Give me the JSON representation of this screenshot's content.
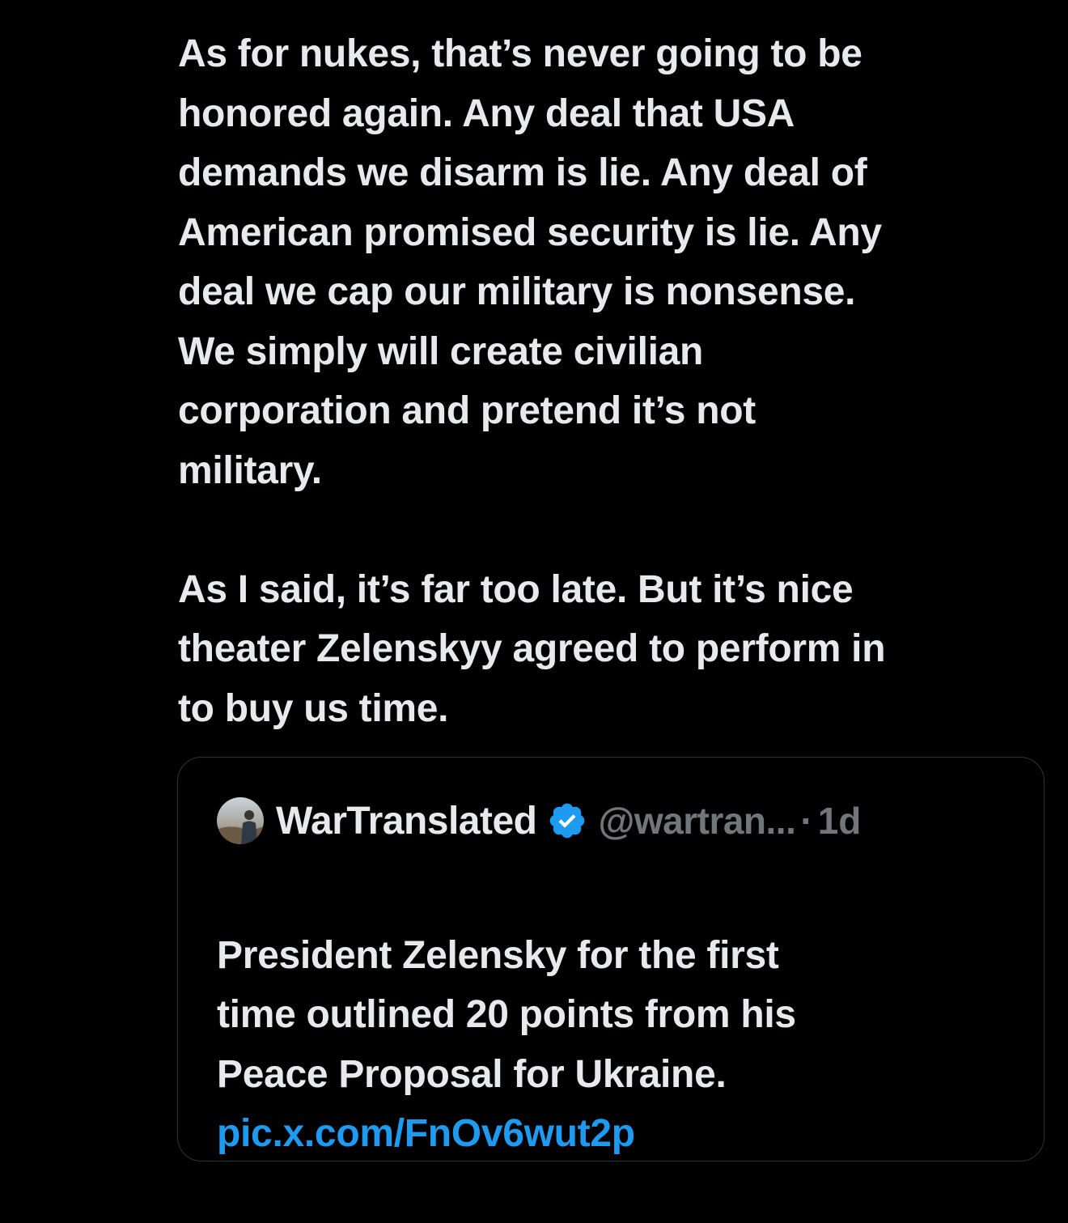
{
  "tweet": {
    "paragraphs": [
      "As for nukes, that’s never going to be\nhonored again. Any deal that USA\ndemands we disarm is lie. Any deal of\nAmerican promised security is lie. Any\ndeal we cap our military is nonsense.\nWe simply will create civilian\ncorporation and pretend it’s not\nmilitary.",
      "As I said, it’s far too late. But it’s nice\ntheater Zelenskyy agreed to perform in\nto buy us time."
    ]
  },
  "quoted_tweet": {
    "display_name": "WarTranslated",
    "verified_icon": "verified-badge-icon",
    "handle": "@wartran...",
    "separator": "·",
    "time": "1d",
    "text": "President Zelensky for the first\ntime outlined 20 points from his\nPeace Proposal for Ukraine.",
    "link": "pic.x.com/FnOv6wut2p"
  },
  "colors": {
    "background": "#000000",
    "text": "#e7e9ea",
    "muted": "#71767b",
    "link": "#1d9bf0",
    "border": "#2f3336",
    "verified": "#1d9bf0"
  }
}
